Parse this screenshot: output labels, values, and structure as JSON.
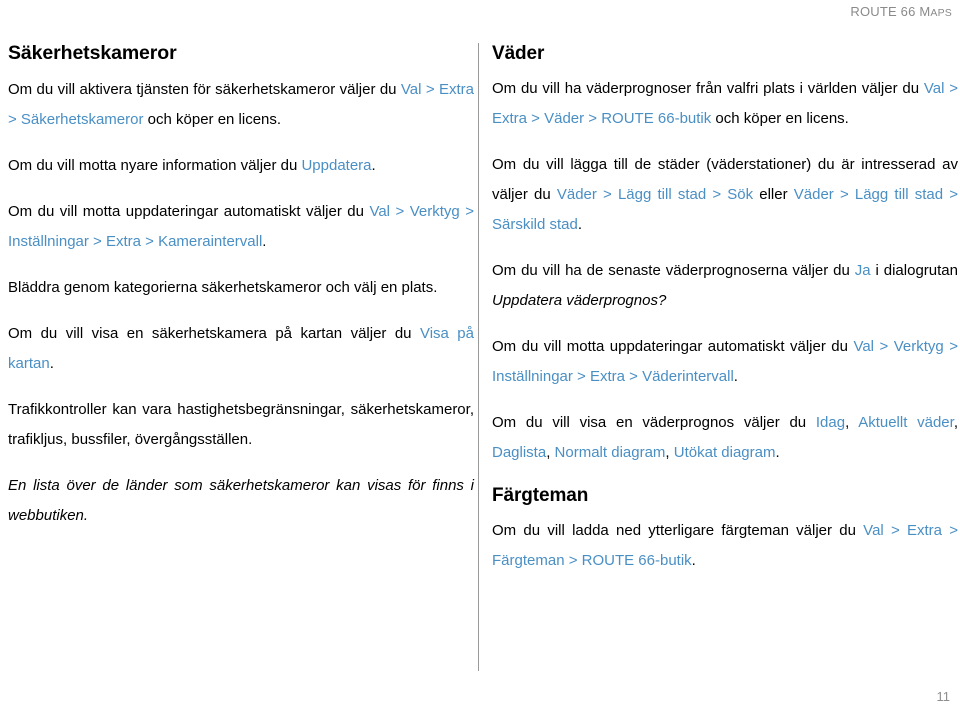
{
  "header": {
    "running_title_main": "ROUTE 66 M",
    "running_title_smallcaps": "APS"
  },
  "colors": {
    "link": "#4a8fc4",
    "text": "#000000",
    "header_gray": "#8a8a8a",
    "divider": "#9a9a9a"
  },
  "left_column": {
    "heading": "Säkerhetskameror",
    "paragraphs": [
      {
        "id": "p-aktivera",
        "runs": [
          {
            "text": "Om du vill aktivera tjänsten för säkerhetskameror väljer du ",
            "style": "plain"
          },
          {
            "text": "Val > Extra > Säkerhetskameror",
            "style": "link"
          },
          {
            "text": " och köper en licens.",
            "style": "plain"
          }
        ]
      },
      {
        "id": "p-nyare-info",
        "runs": [
          {
            "text": "Om du vill motta nyare information väljer du ",
            "style": "plain"
          },
          {
            "text": "Uppdatera",
            "style": "link"
          },
          {
            "text": ".",
            "style": "plain"
          }
        ]
      },
      {
        "id": "p-uppdateringar",
        "runs": [
          {
            "text": "Om du vill motta uppdateringar automatiskt väljer du ",
            "style": "plain"
          },
          {
            "text": "Val > Verktyg > Inställningar > Extra > Kameraintervall",
            "style": "link"
          },
          {
            "text": ".",
            "style": "plain"
          }
        ]
      },
      {
        "id": "p-bladdra",
        "runs": [
          {
            "text": "Bläddra genom kategorierna säkerhetskameror och välj en plats.",
            "style": "plain"
          }
        ]
      },
      {
        "id": "p-visa-kartan",
        "runs": [
          {
            "text": "Om du vill visa en säkerhetskamera på kartan väljer du ",
            "style": "plain"
          },
          {
            "text": "Visa på kartan",
            "style": "link"
          },
          {
            "text": ".",
            "style": "plain"
          }
        ]
      },
      {
        "id": "p-trafikkontroller",
        "runs": [
          {
            "text": "Trafikkontroller kan vara hastighetsbegränsningar, säkerhetskameror, trafikljus, bussfiler, övergångsställen.",
            "style": "plain"
          }
        ]
      },
      {
        "id": "p-lista-lander",
        "italic": true,
        "runs": [
          {
            "text": "En lista över de länder som säkerhetskameror kan visas för finns i webbutiken.",
            "style": "plain"
          }
        ]
      }
    ]
  },
  "right_column": {
    "sections": [
      {
        "id": "section-vader",
        "heading": "Väder",
        "paragraphs": [
          {
            "id": "p-vaderprognoser",
            "runs": [
              {
                "text": "Om du vill ha väderprognoser från valfri plats i världen väljer du ",
                "style": "plain"
              },
              {
                "text": "Val > Extra > Väder > ROUTE 66-butik",
                "style": "link"
              },
              {
                "text": " och köper en licens.",
                "style": "plain"
              }
            ]
          },
          {
            "id": "p-lagga-till-stader",
            "runs": [
              {
                "text": "Om du vill lägga till de städer (väderstationer) du är intresserad av väljer du ",
                "style": "plain"
              },
              {
                "text": "Väder > Lägg till stad > Sök",
                "style": "link"
              },
              {
                "text": " eller ",
                "style": "plain"
              },
              {
                "text": "Väder > Lägg till stad > Särskild stad",
                "style": "link"
              },
              {
                "text": ".",
                "style": "plain"
              }
            ]
          },
          {
            "id": "p-senaste-prognoser",
            "runs": [
              {
                "text": "Om du vill ha de senaste väderprognoserna väljer du ",
                "style": "plain"
              },
              {
                "text": "Ja",
                "style": "link"
              },
              {
                "text": " i dialogrutan ",
                "style": "plain"
              },
              {
                "text": "Uppdatera väderprognos?",
                "style": "italic"
              }
            ]
          },
          {
            "id": "p-uppdateringar-vader",
            "runs": [
              {
                "text": "Om du vill motta uppdateringar automatiskt väljer du ",
                "style": "plain"
              },
              {
                "text": "Val > Verktyg > Inställningar > Extra > Väderintervall",
                "style": "link"
              },
              {
                "text": ".",
                "style": "plain"
              }
            ]
          },
          {
            "id": "p-visa-vaderprognos",
            "runs": [
              {
                "text": "Om du vill visa en väderprognos väljer du ",
                "style": "plain"
              },
              {
                "text": "Idag",
                "style": "link"
              },
              {
                "text": ", ",
                "style": "plain"
              },
              {
                "text": "Aktuellt väder",
                "style": "link"
              },
              {
                "text": ", ",
                "style": "plain"
              },
              {
                "text": "Daglista",
                "style": "link"
              },
              {
                "text": ", ",
                "style": "plain"
              },
              {
                "text": "Normalt diagram",
                "style": "link"
              },
              {
                "text": ", ",
                "style": "plain"
              },
              {
                "text": "Utökat diagram",
                "style": "link"
              },
              {
                "text": ".",
                "style": "plain"
              }
            ]
          }
        ]
      },
      {
        "id": "section-fargteman",
        "heading": "Färgteman",
        "paragraphs": [
          {
            "id": "p-fargteman",
            "runs": [
              {
                "text": "Om du vill ladda ned ytterligare färgteman väljer du ",
                "style": "plain"
              },
              {
                "text": "Val > Extra > Färgteman > ROUTE 66-butik",
                "style": "link"
              },
              {
                "text": ".",
                "style": "plain"
              }
            ]
          }
        ]
      }
    ]
  },
  "footer": {
    "page_number": "11"
  }
}
